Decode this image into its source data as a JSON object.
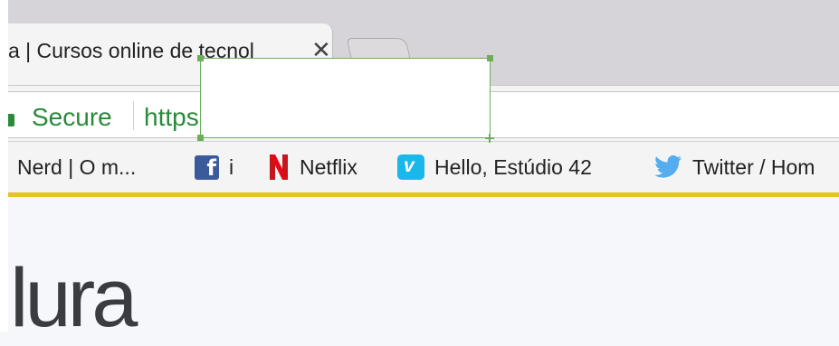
{
  "tab": {
    "title": "a | Cursos online de tecnol",
    "close_glyph": "✕"
  },
  "omnibox": {
    "secure_label": "Secure",
    "url_text": "https:"
  },
  "bookmarks": {
    "items": [
      {
        "label": "Nerd | O m...",
        "icon": "none"
      },
      {
        "label": "i",
        "icon": "facebook-icon"
      },
      {
        "label": "Netflix",
        "icon": "netflix-icon"
      },
      {
        "label": "Hello, Estúdio 42",
        "icon": "vimeo-icon"
      },
      {
        "label": "Twitter / Hom",
        "icon": "twitter-icon"
      }
    ]
  },
  "page": {
    "logo_text": "lura"
  },
  "colors": {
    "secure_green": "#2a8a3a",
    "accent_yellow": "#e9c21c",
    "selection_border": "#6cae5a"
  }
}
